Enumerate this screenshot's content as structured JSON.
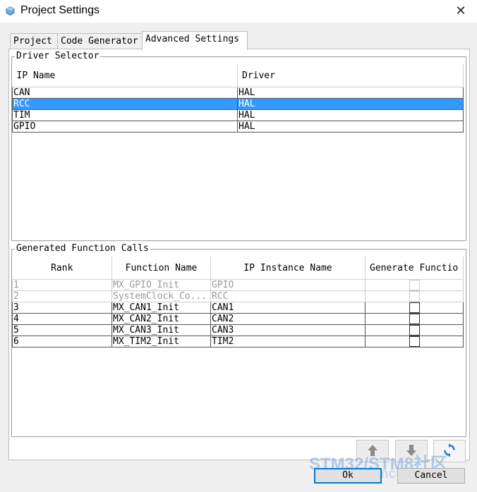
{
  "window": {
    "title": "Project Settings",
    "close_glyph": "✕"
  },
  "tabs": [
    {
      "label": "Project",
      "active": false
    },
    {
      "label": "Code Generator",
      "active": false
    },
    {
      "label": "Advanced Settings",
      "active": true
    }
  ],
  "driver_selector": {
    "label": "Driver Selector",
    "columns": [
      "IP Name",
      "Driver"
    ],
    "rows": [
      {
        "ip": "CAN",
        "driver": "HAL",
        "selected": false
      },
      {
        "ip": "RCC",
        "driver": "HAL",
        "selected": true
      },
      {
        "ip": "TIM",
        "driver": "HAL",
        "selected": false
      },
      {
        "ip": "GPIO",
        "driver": "HAL",
        "selected": false
      }
    ]
  },
  "function_calls": {
    "label": "Generated Function Calls",
    "columns": [
      "Rank",
      "Function Name",
      "IP Instance Name",
      "Generate Functio"
    ],
    "rows": [
      {
        "rank": "1",
        "function": "MX_GPIO_Init",
        "instance": "GPIO",
        "enabled": false
      },
      {
        "rank": "2",
        "function": "SystemClock_Co...",
        "instance": "RCC",
        "enabled": false
      },
      {
        "rank": "3",
        "function": "MX_CAN1_Init",
        "instance": "CAN1",
        "enabled": true
      },
      {
        "rank": "4",
        "function": "MX_CAN2_Init",
        "instance": "CAN2",
        "enabled": true
      },
      {
        "rank": "5",
        "function": "MX_CAN3_Init",
        "instance": "CAN3",
        "enabled": true
      },
      {
        "rank": "6",
        "function": "MX_TIM2_Init",
        "instance": "TIM2",
        "enabled": true
      }
    ]
  },
  "toolbar": {
    "move_up_icon": "arrow-up-icon",
    "move_down_icon": "arrow-down-icon",
    "refresh_icon": "refresh-icon"
  },
  "buttons": {
    "ok": "Ok",
    "cancel": "Cancel"
  },
  "watermark": {
    "line1": "STM32/STM8社区",
    "line2": "www.stmcu.org"
  },
  "colors": {
    "selection": "#3399ff",
    "refresh": "#1e6fd9"
  }
}
